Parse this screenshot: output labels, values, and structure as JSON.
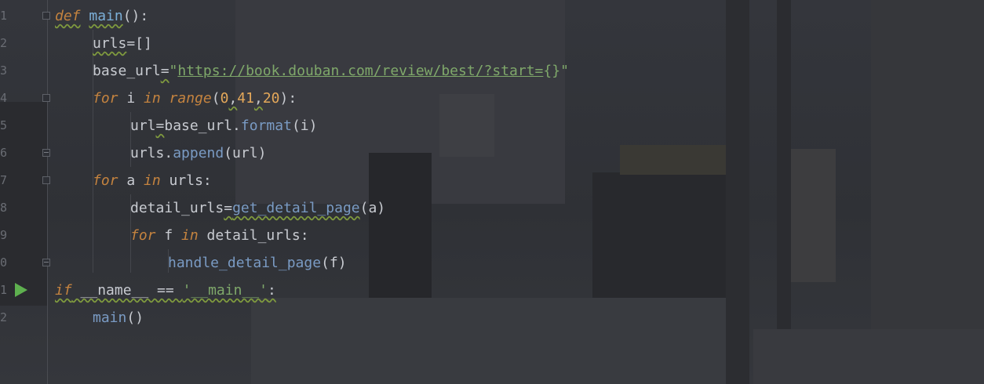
{
  "editor": {
    "line_numbers": [
      "1",
      "2",
      "3",
      "4",
      "5",
      "6",
      "7",
      "8",
      "9",
      "0",
      "1",
      "2"
    ],
    "lines": [
      {
        "kw": "def",
        "sp": " ",
        "name": "main",
        "rest": "():"
      },
      {
        "a": "urls",
        "b": "=[]"
      },
      {
        "a": "base_url",
        "eq": "=",
        "q1": "\"",
        "url": "https://book.douban.com/review/best/?start=",
        "braces": "{}",
        "q2": "\""
      },
      {
        "kw": "for",
        "a": " i ",
        "kw2": "in",
        "sp": " ",
        "fn": "range",
        "p1": "(",
        "n1": "0",
        "c1": ",",
        "n2": "41",
        "c2": ",",
        "n3": "20",
        "p2": "):"
      },
      {
        "a": "url",
        "eq": "=",
        "b": "base_url.",
        "meth": "format",
        "c": "(i)"
      },
      {
        "a": "urls.",
        "meth": "append",
        "c": "(url)"
      },
      {
        "kw": "for",
        "a": " a ",
        "kw2": "in",
        "b": " urls:"
      },
      {
        "a": "detail_urls",
        "eq": "=",
        "fn": "get_detail_page",
        "c": "(a)"
      },
      {
        "kw": "for",
        "a": " f ",
        "kw2": "in",
        "b": " detail_urls:"
      },
      {
        "fn": "handle_detail_page",
        "c": "(f)"
      },
      {
        "kw": "if",
        "a": " __name__ == ",
        "str": "'__main__'",
        "b": ":"
      },
      {
        "fn": "main",
        "c": "()"
      }
    ]
  }
}
